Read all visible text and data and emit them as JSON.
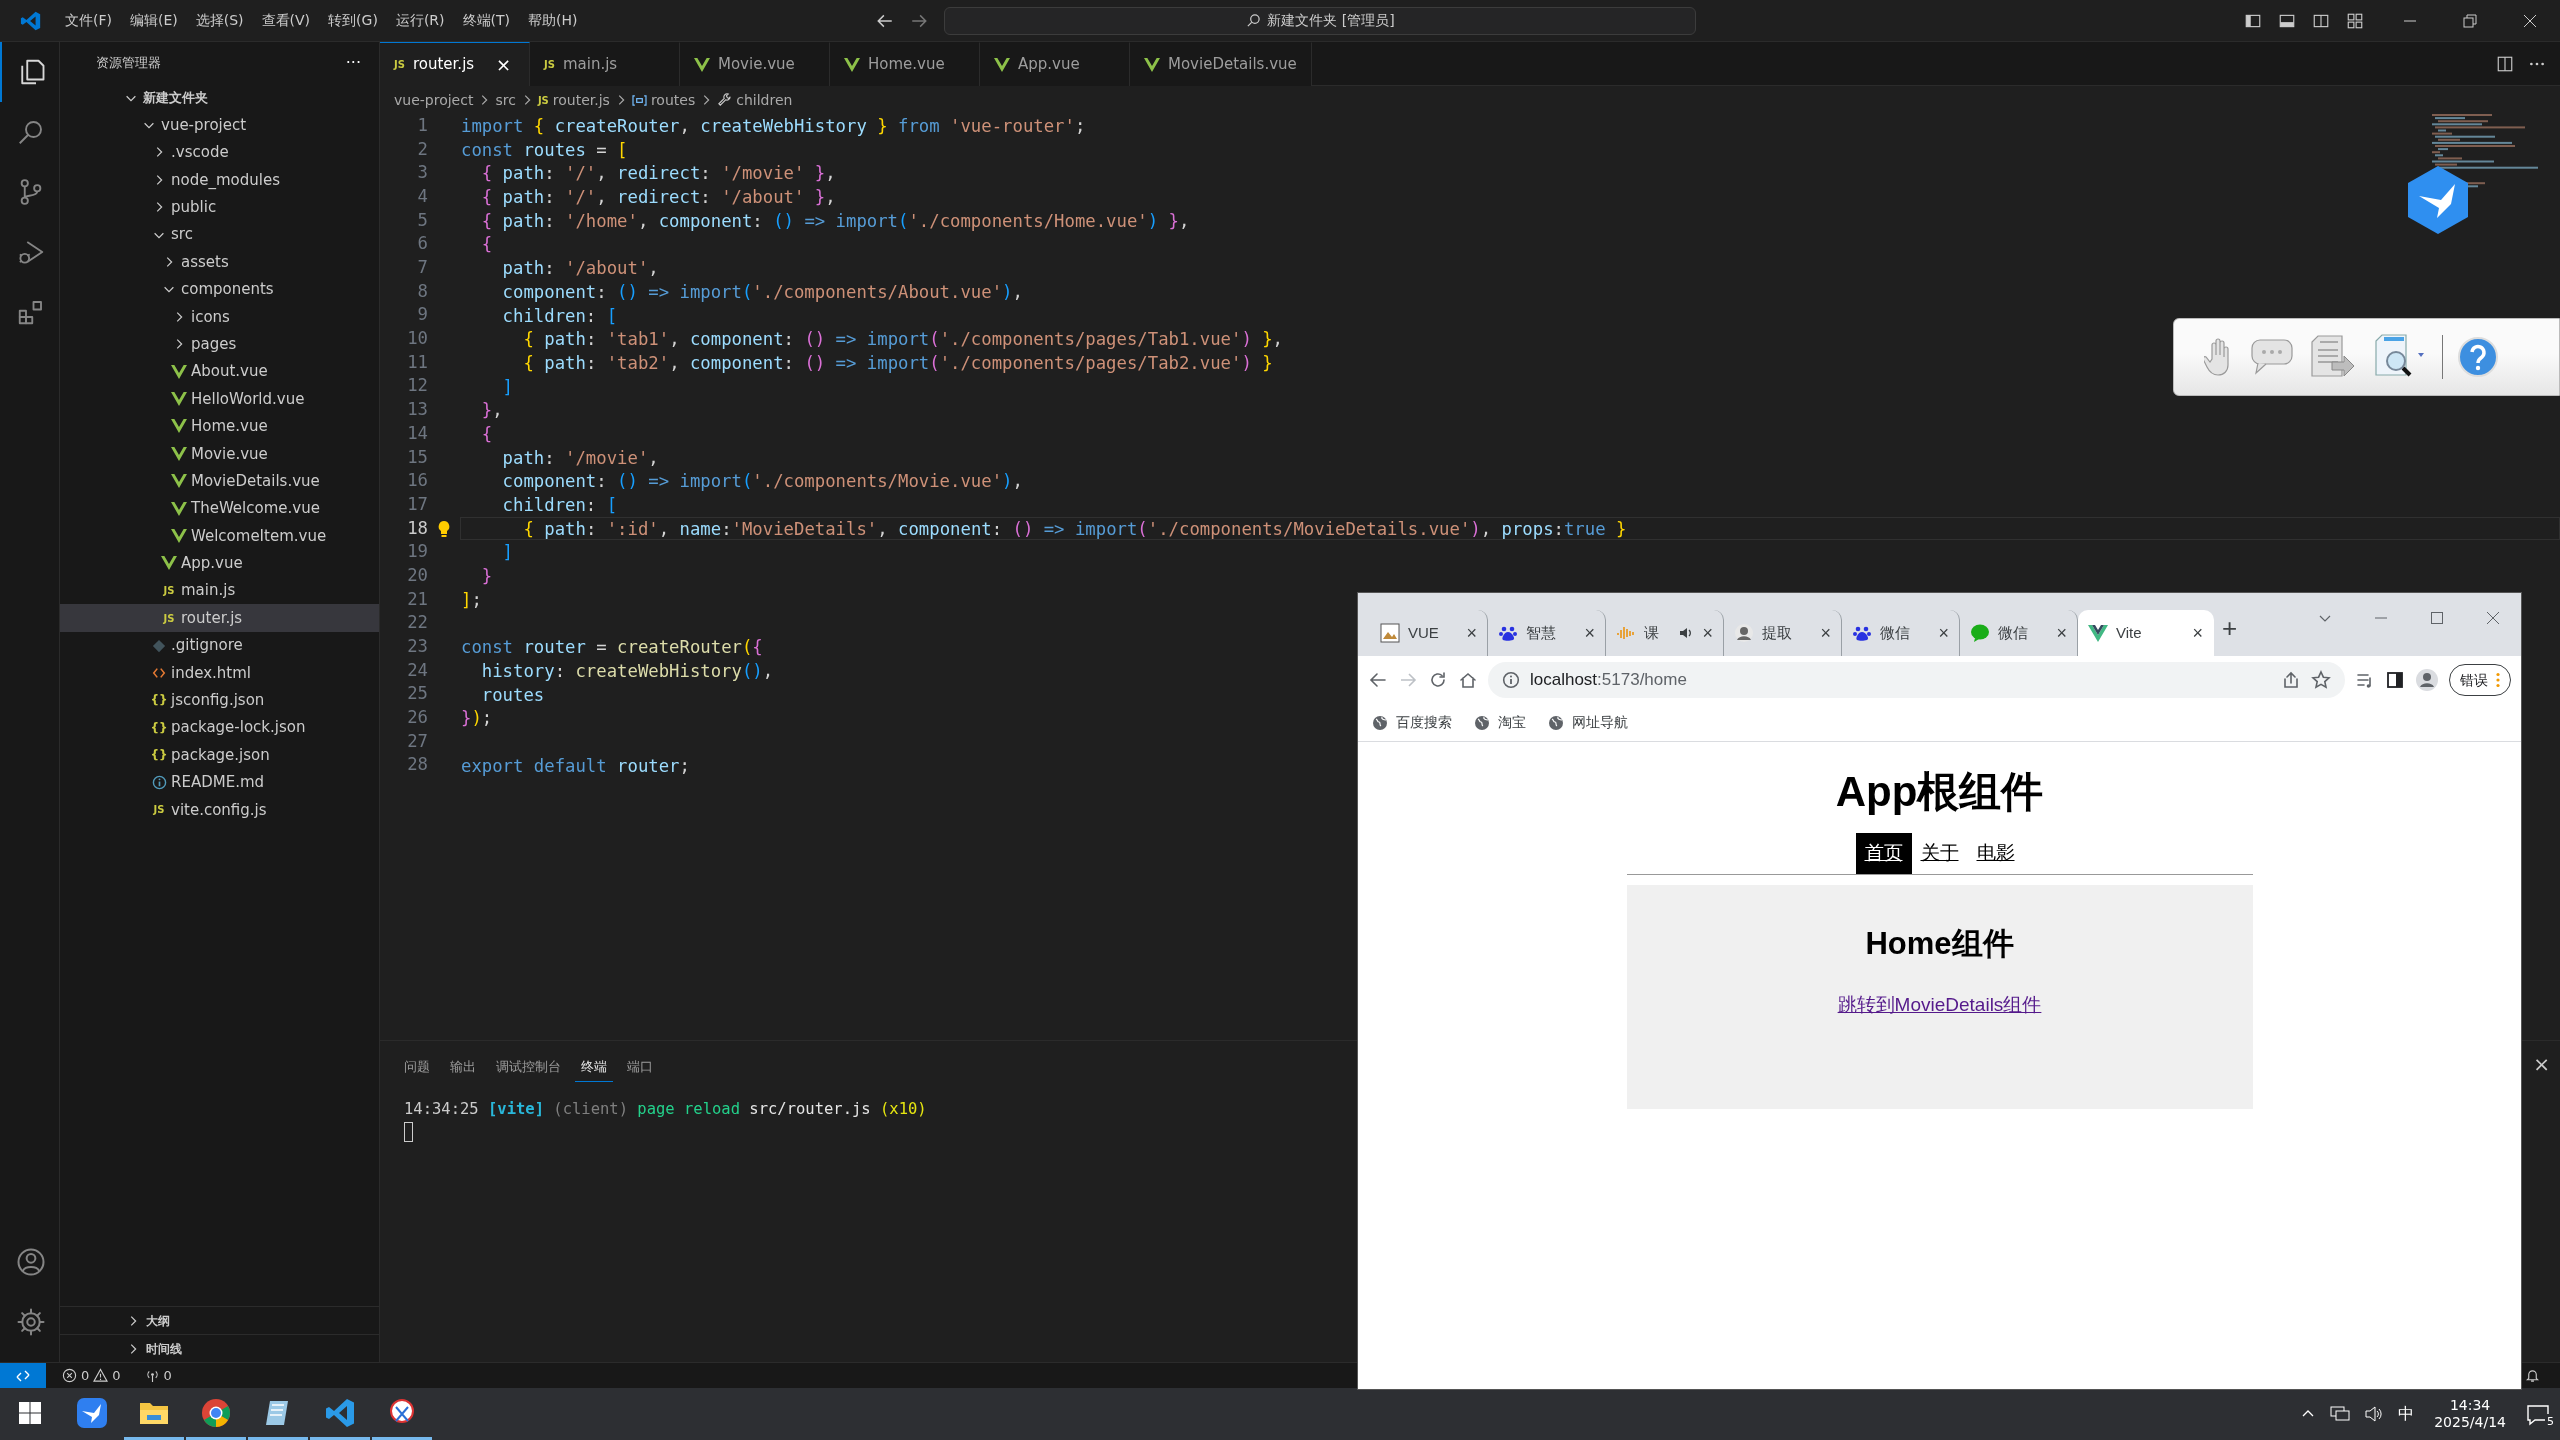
{
  "menu_bar": {
    "items": [
      "文件(F)",
      "编辑(E)",
      "选择(S)",
      "查看(V)",
      "转到(G)",
      "运行(R)",
      "终端(T)",
      "帮助(H)"
    ],
    "search": "新建文件夹 [管理员]"
  },
  "activity_bar": [
    {
      "kind": "files",
      "selected": true
    },
    {
      "kind": "search",
      "selected": false
    },
    {
      "kind": "source-control",
      "selected": false
    },
    {
      "kind": "run",
      "selected": false
    },
    {
      "kind": "extensions",
      "selected": false
    }
  ],
  "sidebar": {
    "title": "资源管理器",
    "more": "···",
    "section": {
      "label": "新建文件夹",
      "expanded": true
    },
    "tree": [
      {
        "label": "vue-project",
        "kind": "folder",
        "expanded": true,
        "selected": false,
        "children": [
          {
            "label": ".vscode",
            "kind": "folder",
            "expanded": false,
            "selected": false
          },
          {
            "label": "node_modules",
            "kind": "folder",
            "expanded": false,
            "selected": false
          },
          {
            "label": "public",
            "kind": "folder",
            "expanded": false,
            "selected": false
          },
          {
            "label": "src",
            "kind": "folder",
            "expanded": true,
            "selected": false,
            "children": [
              {
                "label": "assets",
                "kind": "folder",
                "expanded": false,
                "selected": false
              },
              {
                "label": "components",
                "kind": "folder",
                "expanded": true,
                "selected": false,
                "children": [
                  {
                    "label": "icons",
                    "kind": "folder",
                    "expanded": false,
                    "selected": false
                  },
                  {
                    "label": "pages",
                    "kind": "folder",
                    "expanded": false,
                    "selected": false
                  },
                  {
                    "label": "About.vue",
                    "kind": "vue",
                    "selected": false
                  },
                  {
                    "label": "HelloWorld.vue",
                    "kind": "vue",
                    "selected": false
                  },
                  {
                    "label": "Home.vue",
                    "kind": "vue",
                    "selected": false
                  },
                  {
                    "label": "Movie.vue",
                    "kind": "vue",
                    "selected": false
                  },
                  {
                    "label": "MovieDetails.vue",
                    "kind": "vue",
                    "selected": false
                  },
                  {
                    "label": "TheWelcome.vue",
                    "kind": "vue",
                    "selected": false
                  },
                  {
                    "label": "WelcomeItem.vue",
                    "kind": "vue",
                    "selected": false
                  }
                ]
              },
              {
                "label": "App.vue",
                "kind": "vue",
                "selected": false
              },
              {
                "label": "main.js",
                "kind": "js",
                "icon_text": "JS",
                "selected": false
              },
              {
                "label": "router.js",
                "kind": "js",
                "icon_text": "JS",
                "selected": true
              }
            ]
          },
          {
            "label": ".gitignore",
            "kind": "git",
            "selected": false
          },
          {
            "label": "index.html",
            "kind": "html",
            "selected": false
          },
          {
            "label": "jsconfig.json",
            "kind": "json",
            "icon_text": "{}",
            "selected": false
          },
          {
            "label": "package-lock.json",
            "kind": "json",
            "icon_text": "{}",
            "selected": false
          },
          {
            "label": "package.json",
            "kind": "json",
            "icon_text": "{}",
            "selected": false
          },
          {
            "label": "README.md",
            "kind": "info",
            "selected": false
          },
          {
            "label": "vite.config.js",
            "kind": "js",
            "icon_text": "JS",
            "selected": false
          }
        ]
      }
    ],
    "bottom_sections": [
      {
        "label": "大纲",
        "expanded": false
      },
      {
        "label": "时间线",
        "expanded": false
      }
    ]
  },
  "editor_tabs": [
    {
      "label": "router.js",
      "kind": "js",
      "icon_text": "JS",
      "selected": true,
      "close": "×"
    },
    {
      "label": "main.js",
      "kind": "js",
      "icon_text": "JS",
      "selected": false
    },
    {
      "label": "Movie.vue",
      "kind": "vue",
      "selected": false
    },
    {
      "label": "Home.vue",
      "kind": "vue",
      "selected": false
    },
    {
      "label": "App.vue",
      "kind": "vue",
      "selected": false
    },
    {
      "label": "MovieDetails.vue",
      "kind": "vue",
      "selected": false
    }
  ],
  "breadcrumb": [
    {
      "label": "vue-project",
      "kind": "folder"
    },
    {
      "label": "src",
      "kind": "folder"
    },
    {
      "label": "router.js",
      "kind": "js",
      "icon_text": "JS"
    },
    {
      "label": "routes",
      "kind": "variable"
    },
    {
      "label": "children",
      "kind": "property"
    }
  ],
  "code_lines": [
    {
      "number": "1",
      "selected": false,
      "tokens": [
        {
          "kind": "kw",
          "text": "import "
        },
        {
          "kind": "b1",
          "text": "{"
        },
        {
          "kind": "var",
          "text": " createRouter"
        },
        {
          "kind": "txt",
          "text": ", "
        },
        {
          "kind": "var",
          "text": "createWebHistory "
        },
        {
          "kind": "b1",
          "text": "}"
        },
        {
          "kind": "kw",
          "text": " from "
        },
        {
          "kind": "str",
          "text": "'vue-router'"
        },
        {
          "kind": "txt",
          "text": ";"
        }
      ]
    },
    {
      "number": "2",
      "selected": false,
      "tokens": [
        {
          "kind": "kw",
          "text": "const "
        },
        {
          "kind": "var",
          "text": "routes"
        },
        {
          "kind": "txt",
          "text": " = "
        },
        {
          "kind": "b1",
          "text": "["
        }
      ]
    },
    {
      "number": "3",
      "selected": false,
      "tokens": [
        {
          "kind": "b2",
          "text": "  {"
        },
        {
          "kind": "var",
          "text": " path"
        },
        {
          "kind": "txt",
          "text": ": "
        },
        {
          "kind": "str",
          "text": "'/'"
        },
        {
          "kind": "txt",
          "text": ", "
        },
        {
          "kind": "var",
          "text": "redirect"
        },
        {
          "kind": "txt",
          "text": ": "
        },
        {
          "kind": "str",
          "text": "'/movie'"
        },
        {
          "kind": "b2",
          "text": " }"
        },
        {
          "kind": "txt",
          "text": ","
        }
      ]
    },
    {
      "number": "4",
      "selected": false,
      "tokens": [
        {
          "kind": "b2",
          "text": "  {"
        },
        {
          "kind": "var",
          "text": " path"
        },
        {
          "kind": "txt",
          "text": ": "
        },
        {
          "kind": "str",
          "text": "'/'"
        },
        {
          "kind": "txt",
          "text": ", "
        },
        {
          "kind": "var",
          "text": "redirect"
        },
        {
          "kind": "txt",
          "text": ": "
        },
        {
          "kind": "str",
          "text": "'/about'"
        },
        {
          "kind": "b2",
          "text": " }"
        },
        {
          "kind": "txt",
          "text": ","
        }
      ]
    },
    {
      "number": "5",
      "selected": false,
      "tokens": [
        {
          "kind": "b2",
          "text": "  {"
        },
        {
          "kind": "var",
          "text": " path"
        },
        {
          "kind": "txt",
          "text": ": "
        },
        {
          "kind": "str",
          "text": "'/home'"
        },
        {
          "kind": "txt",
          "text": ", "
        },
        {
          "kind": "var",
          "text": "component"
        },
        {
          "kind": "txt",
          "text": ": "
        },
        {
          "kind": "b3",
          "text": "()"
        },
        {
          "kind": "kw",
          "text": " => import"
        },
        {
          "kind": "b3",
          "text": "("
        },
        {
          "kind": "str",
          "text": "'./components/Home.vue'"
        },
        {
          "kind": "b3",
          "text": ")"
        },
        {
          "kind": "b2",
          "text": " }"
        },
        {
          "kind": "txt",
          "text": ","
        }
      ]
    },
    {
      "number": "6",
      "selected": false,
      "tokens": [
        {
          "kind": "b2",
          "text": "  {"
        }
      ]
    },
    {
      "number": "7",
      "selected": false,
      "tokens": [
        {
          "kind": "var",
          "text": "    path"
        },
        {
          "kind": "txt",
          "text": ": "
        },
        {
          "kind": "str",
          "text": "'/about'"
        },
        {
          "kind": "txt",
          "text": ","
        }
      ]
    },
    {
      "number": "8",
      "selected": false,
      "tokens": [
        {
          "kind": "var",
          "text": "    component"
        },
        {
          "kind": "txt",
          "text": ": "
        },
        {
          "kind": "b3",
          "text": "()"
        },
        {
          "kind": "kw",
          "text": " => import"
        },
        {
          "kind": "b3",
          "text": "("
        },
        {
          "kind": "str",
          "text": "'./components/About.vue'"
        },
        {
          "kind": "b3",
          "text": ")"
        },
        {
          "kind": "txt",
          "text": ","
        }
      ]
    },
    {
      "number": "9",
      "selected": false,
      "tokens": [
        {
          "kind": "var",
          "text": "    children"
        },
        {
          "kind": "txt",
          "text": ": "
        },
        {
          "kind": "b3",
          "text": "["
        }
      ]
    },
    {
      "number": "10",
      "selected": false,
      "tokens": [
        {
          "kind": "b1",
          "text": "      {"
        },
        {
          "kind": "var",
          "text": " path"
        },
        {
          "kind": "txt",
          "text": ": "
        },
        {
          "kind": "str",
          "text": "'tab1'"
        },
        {
          "kind": "txt",
          "text": ", "
        },
        {
          "kind": "var",
          "text": "component"
        },
        {
          "kind": "txt",
          "text": ": "
        },
        {
          "kind": "b2",
          "text": "()"
        },
        {
          "kind": "kw",
          "text": " => import"
        },
        {
          "kind": "b2",
          "text": "("
        },
        {
          "kind": "str",
          "text": "'./components/pages/Tab1.vue'"
        },
        {
          "kind": "b2",
          "text": ")"
        },
        {
          "kind": "b1",
          "text": " }"
        },
        {
          "kind": "txt",
          "text": ","
        }
      ]
    },
    {
      "number": "11",
      "selected": false,
      "tokens": [
        {
          "kind": "b1",
          "text": "      {"
        },
        {
          "kind": "var",
          "text": " path"
        },
        {
          "kind": "txt",
          "text": ": "
        },
        {
          "kind": "str",
          "text": "'tab2'"
        },
        {
          "kind": "txt",
          "text": ", "
        },
        {
          "kind": "var",
          "text": "component"
        },
        {
          "kind": "txt",
          "text": ": "
        },
        {
          "kind": "b2",
          "text": "()"
        },
        {
          "kind": "kw",
          "text": " => import"
        },
        {
          "kind": "b2",
          "text": "("
        },
        {
          "kind": "str",
          "text": "'./components/pages/Tab2.vue'"
        },
        {
          "kind": "b2",
          "text": ")"
        },
        {
          "kind": "b1",
          "text": " }"
        }
      ]
    },
    {
      "number": "12",
      "selected": false,
      "tokens": [
        {
          "kind": "b3",
          "text": "    ]"
        }
      ]
    },
    {
      "number": "13",
      "selected": false,
      "tokens": [
        {
          "kind": "b2",
          "text": "  }"
        },
        {
          "kind": "txt",
          "text": ","
        }
      ]
    },
    {
      "number": "14",
      "selected": false,
      "tokens": [
        {
          "kind": "b2",
          "text": "  {"
        }
      ]
    },
    {
      "number": "15",
      "selected": false,
      "tokens": [
        {
          "kind": "var",
          "text": "    path"
        },
        {
          "kind": "txt",
          "text": ": "
        },
        {
          "kind": "str",
          "text": "'/movie'"
        },
        {
          "kind": "txt",
          "text": ","
        }
      ]
    },
    {
      "number": "16",
      "selected": false,
      "tokens": [
        {
          "kind": "var",
          "text": "    component"
        },
        {
          "kind": "txt",
          "text": ": "
        },
        {
          "kind": "b3",
          "text": "()"
        },
        {
          "kind": "kw",
          "text": " => import"
        },
        {
          "kind": "b3",
          "text": "("
        },
        {
          "kind": "str",
          "text": "'./components/Movie.vue'"
        },
        {
          "kind": "b3",
          "text": ")"
        },
        {
          "kind": "txt",
          "text": ","
        }
      ]
    },
    {
      "number": "17",
      "selected": false,
      "tokens": [
        {
          "kind": "var",
          "text": "    children"
        },
        {
          "kind": "txt",
          "text": ": "
        },
        {
          "kind": "b3",
          "text": "["
        }
      ]
    },
    {
      "number": "18",
      "selected": true,
      "tokens": [
        {
          "kind": "b1",
          "text": "      {"
        },
        {
          "kind": "var",
          "text": " path"
        },
        {
          "kind": "txt",
          "text": ": "
        },
        {
          "kind": "str",
          "text": "':id'"
        },
        {
          "kind": "txt",
          "text": ", "
        },
        {
          "kind": "var",
          "text": "name"
        },
        {
          "kind": "txt",
          "text": ":"
        },
        {
          "kind": "str",
          "text": "'MovieDetails'"
        },
        {
          "kind": "txt",
          "text": ", "
        },
        {
          "kind": "var",
          "text": "component"
        },
        {
          "kind": "txt",
          "text": ": "
        },
        {
          "kind": "b2",
          "text": "()"
        },
        {
          "kind": "kw",
          "text": " => import"
        },
        {
          "kind": "b2",
          "text": "("
        },
        {
          "kind": "str",
          "text": "'./components/MovieDetails.vue'"
        },
        {
          "kind": "b2",
          "text": ")"
        },
        {
          "kind": "txt",
          "text": ", "
        },
        {
          "kind": "var",
          "text": "props"
        },
        {
          "kind": "txt",
          "text": ":"
        },
        {
          "kind": "kw",
          "text": "true"
        },
        {
          "kind": "b1",
          "text": " }"
        }
      ]
    },
    {
      "number": "19",
      "selected": false,
      "tokens": [
        {
          "kind": "b3",
          "text": "    ]"
        }
      ]
    },
    {
      "number": "20",
      "selected": false,
      "tokens": [
        {
          "kind": "b2",
          "text": "  }"
        }
      ]
    },
    {
      "number": "21",
      "selected": false,
      "tokens": [
        {
          "kind": "b1",
          "text": "]"
        },
        {
          "kind": "txt",
          "text": ";"
        }
      ]
    },
    {
      "number": "22",
      "selected": false
    },
    {
      "number": "23",
      "selected": false,
      "tokens": [
        {
          "kind": "kw",
          "text": "const "
        },
        {
          "kind": "var",
          "text": "router"
        },
        {
          "kind": "txt",
          "text": " = "
        },
        {
          "kind": "fn",
          "text": "createRouter"
        },
        {
          "kind": "b1",
          "text": "("
        },
        {
          "kind": "b2",
          "text": "{"
        }
      ]
    },
    {
      "number": "24",
      "selected": false,
      "tokens": [
        {
          "kind": "var",
          "text": "  history"
        },
        {
          "kind": "txt",
          "text": ": "
        },
        {
          "kind": "fn",
          "text": "createWebHistory"
        },
        {
          "kind": "b3",
          "text": "()"
        },
        {
          "kind": "txt",
          "text": ","
        }
      ]
    },
    {
      "number": "25",
      "selected": false,
      "tokens": [
        {
          "kind": "var",
          "text": "  routes"
        }
      ]
    },
    {
      "number": "26",
      "selected": false,
      "tokens": [
        {
          "kind": "b2",
          "text": "}"
        },
        {
          "kind": "b1",
          "text": ")"
        },
        {
          "kind": "txt",
          "text": ";"
        }
      ]
    },
    {
      "number": "27",
      "selected": false
    },
    {
      "number": "28",
      "selected": false,
      "tokens": [
        {
          "kind": "kw",
          "text": "export default "
        },
        {
          "kind": "var",
          "text": "router"
        },
        {
          "kind": "txt",
          "text": ";"
        }
      ]
    }
  ],
  "panel": {
    "tabs": [
      {
        "label": "问题",
        "selected": false
      },
      {
        "label": "输出",
        "selected": false
      },
      {
        "label": "调试控制台",
        "selected": false
      },
      {
        "label": "终端",
        "selected": true
      },
      {
        "label": "端口",
        "selected": false
      }
    ],
    "close": "×",
    "terminal": [
      {
        "kind": "time",
        "text": "14:34:25 "
      },
      {
        "kind": "tag",
        "text": "[vite]"
      },
      {
        "kind": "dim",
        "text": " (client)"
      },
      {
        "kind": "ok",
        "text": " page reload"
      },
      {
        "kind": "txt",
        "text": " src/router.js "
      },
      {
        "kind": "warn",
        "text": "(x10)"
      }
    ]
  },
  "status_bar": {
    "errors": "0",
    "warnings": "0",
    "ports": "0"
  },
  "browser": {
    "tabs": [
      {
        "label": "VUE",
        "kind": "image",
        "selected": false,
        "playing": false,
        "close": "×"
      },
      {
        "label": "智慧",
        "kind": "paw",
        "selected": false,
        "playing": false,
        "close": "×"
      },
      {
        "label": "课",
        "kind": "bars",
        "selected": false,
        "playing": true,
        "close": "×"
      },
      {
        "label": "提取",
        "kind": "avatar",
        "selected": false,
        "playing": false,
        "close": "×"
      },
      {
        "label": "微信",
        "kind": "paw",
        "selected": false,
        "playing": false,
        "close": "×"
      },
      {
        "label": "微信",
        "kind": "chat",
        "selected": false,
        "playing": false,
        "close": "×"
      },
      {
        "label": "Vite",
        "kind": "vue",
        "selected": true,
        "playing": false,
        "close": "×"
      }
    ],
    "new_tab": "+",
    "address": {
      "host": "localhost",
      "path": ":5173/home"
    },
    "error_button": "错误",
    "bookmarks": [
      "百度搜索",
      "淘宝",
      "网址导航"
    ],
    "page": {
      "title": "App根组件",
      "nav": [
        {
          "label": "首页",
          "selected": true
        },
        {
          "label": "关于",
          "selected": false
        },
        {
          "label": "电影",
          "selected": false
        }
      ],
      "heading": "Home组件",
      "link": "跳转到MovieDetails组件"
    }
  },
  "taskbar": {
    "apps": [
      {
        "kind": "bird",
        "running": false
      },
      {
        "kind": "folder",
        "running": true
      },
      {
        "kind": "chrome",
        "running": true
      },
      {
        "kind": "notes",
        "running": true
      },
      {
        "kind": "vscode",
        "running": true
      },
      {
        "kind": "snip",
        "running": true
      }
    ],
    "ime": "中",
    "time": "14:34",
    "date": "2025/4/14",
    "notifications": "5"
  }
}
